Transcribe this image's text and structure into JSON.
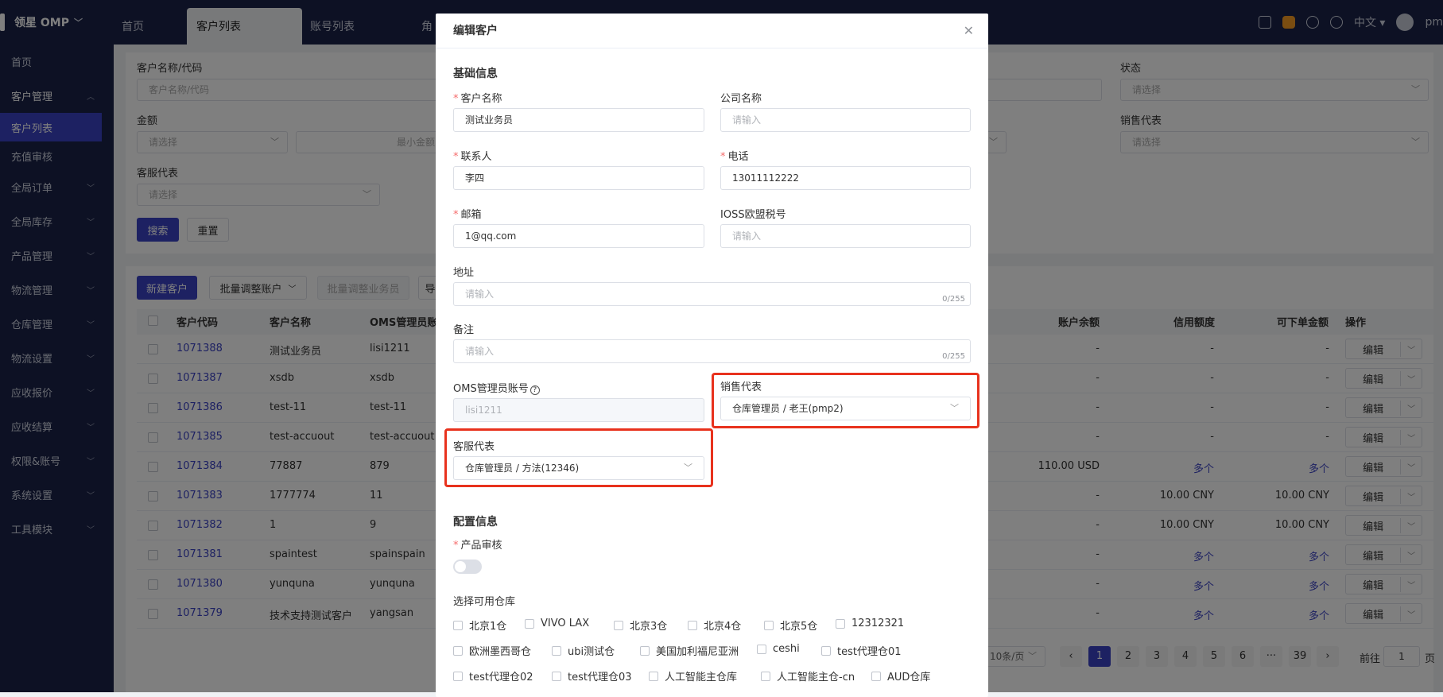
{
  "app": {
    "brand": "领星 OMP"
  },
  "header": {
    "tabs": [
      "首页",
      "客户列表",
      "账号列表",
      "角"
    ],
    "lang": "中文",
    "user": "pm"
  },
  "sidebar": {
    "items": [
      "首页",
      "客户管理",
      "全局订单",
      "全局库存",
      "产品管理",
      "物流管理",
      "仓库管理",
      "物流设置",
      "应收报价",
      "应收结算",
      "权限&账号",
      "系统设置",
      "工具模块"
    ],
    "sub": [
      "客户列表",
      "充值审核"
    ]
  },
  "filter": {
    "name_label": "客户名称/代码",
    "name_placeholder": "客户名称/代码",
    "amount_label": "金额",
    "amount_select": "请选择",
    "amount_min": "最小金额",
    "cs_label": "客服代表",
    "cs_placeholder": "请选择",
    "status_label": "状态",
    "status_placeholder": "请选择",
    "sales_label": "销售代表",
    "sales_placeholder": "请选择",
    "search_btn": "搜索",
    "reset_btn": "重置"
  },
  "toolbar": {
    "new_btn": "新建客户",
    "batch_account_btn": "批量调整账户",
    "batch_sales_btn": "批量调整业务员",
    "export_btn": "导"
  },
  "table": {
    "headers": [
      "客户代码",
      "客户名称",
      "OMS管理员账号",
      "账户余额",
      "信用额度",
      "可下单金额",
      "操作"
    ],
    "rows": [
      {
        "code": "1071388",
        "name": "测试业务员",
        "oms": "lisi1211",
        "balance": "-",
        "credit": "-",
        "order": "-"
      },
      {
        "code": "1071387",
        "name": "xsdb",
        "oms": "xsdb",
        "balance": "-",
        "credit": "-",
        "order": "-"
      },
      {
        "code": "1071386",
        "name": "test-11",
        "oms": "test-11",
        "balance": "-",
        "credit": "-",
        "order": "-"
      },
      {
        "code": "1071385",
        "name": "test-accuout",
        "oms": "test-accuout",
        "balance": "-",
        "credit": "-",
        "order": "-"
      },
      {
        "code": "1071384",
        "name": "77887",
        "oms": "879",
        "balance": "110.00    USD",
        "credit": "多个",
        "order": "多个"
      },
      {
        "code": "1071383",
        "name": "1777774",
        "oms": "11",
        "balance": "-",
        "credit": "10.00    CNY",
        "order": "10.00    CNY"
      },
      {
        "code": "1071382",
        "name": "1",
        "oms": "9",
        "balance": "-",
        "credit": "10.00    CNY",
        "order": "10.00    CNY"
      },
      {
        "code": "1071381",
        "name": "spaintest",
        "oms": "spainspain",
        "balance": "-",
        "credit": "多个",
        "order": "多个"
      },
      {
        "code": "1071380",
        "name": "yunquna",
        "oms": "yunquna",
        "balance": "-",
        "credit": "多个",
        "order": "多个"
      },
      {
        "code": "1071379",
        "name": "技术支持测试客户",
        "oms": "yangsan",
        "balance": "-",
        "credit": "多个",
        "order": "多个"
      }
    ],
    "edit_label": "编辑"
  },
  "pagination": {
    "page_size": "10条/页",
    "pages": [
      "1",
      "2",
      "3",
      "4",
      "5",
      "6",
      "···",
      "39"
    ],
    "goto_label": "前往",
    "goto_value": "1",
    "page_suffix": "页"
  },
  "modal": {
    "title": "编辑客户",
    "basic_section": "基础信息",
    "customer_name_label": "客户名称",
    "customer_name_value": "测试业务员",
    "company_label": "公司名称",
    "company_placeholder": "请输入",
    "contact_label": "联系人",
    "contact_value": "李四",
    "phone_label": "电话",
    "phone_value": "13011112222",
    "email_label": "邮箱",
    "email_value": "1@qq.com",
    "ioss_label": "IOSS欧盟税号",
    "ioss_placeholder": "请输入",
    "address_label": "地址",
    "address_placeholder": "请输入",
    "address_count": "0/255",
    "remark_label": "备注",
    "remark_placeholder": "请输入",
    "remark_count": "0/255",
    "oms_label": "OMS管理员账号",
    "oms_value": "lisi1211",
    "sales_label": "销售代表",
    "sales_value": "仓库管理员 / 老王(pmp2)",
    "cs_label": "客服代表",
    "cs_value": "仓库管理员 / 方法(12346)",
    "config_section": "配置信息",
    "product_review_label": "产品审核",
    "warehouse_label": "选择可用仓库",
    "warehouses": [
      "北京1仓",
      "VIVO LAX",
      "北京3仓",
      "北京4仓",
      "北京5仓",
      "12312321",
      "欧洲墨西哥仓",
      "ubi测试仓",
      "美国加利福尼亚洲",
      "ceshi",
      "test代理仓01",
      "test代理仓02",
      "test代理仓03",
      "人工智能主仓库",
      "人工智能主仓-cn",
      "AUD仓库"
    ]
  }
}
